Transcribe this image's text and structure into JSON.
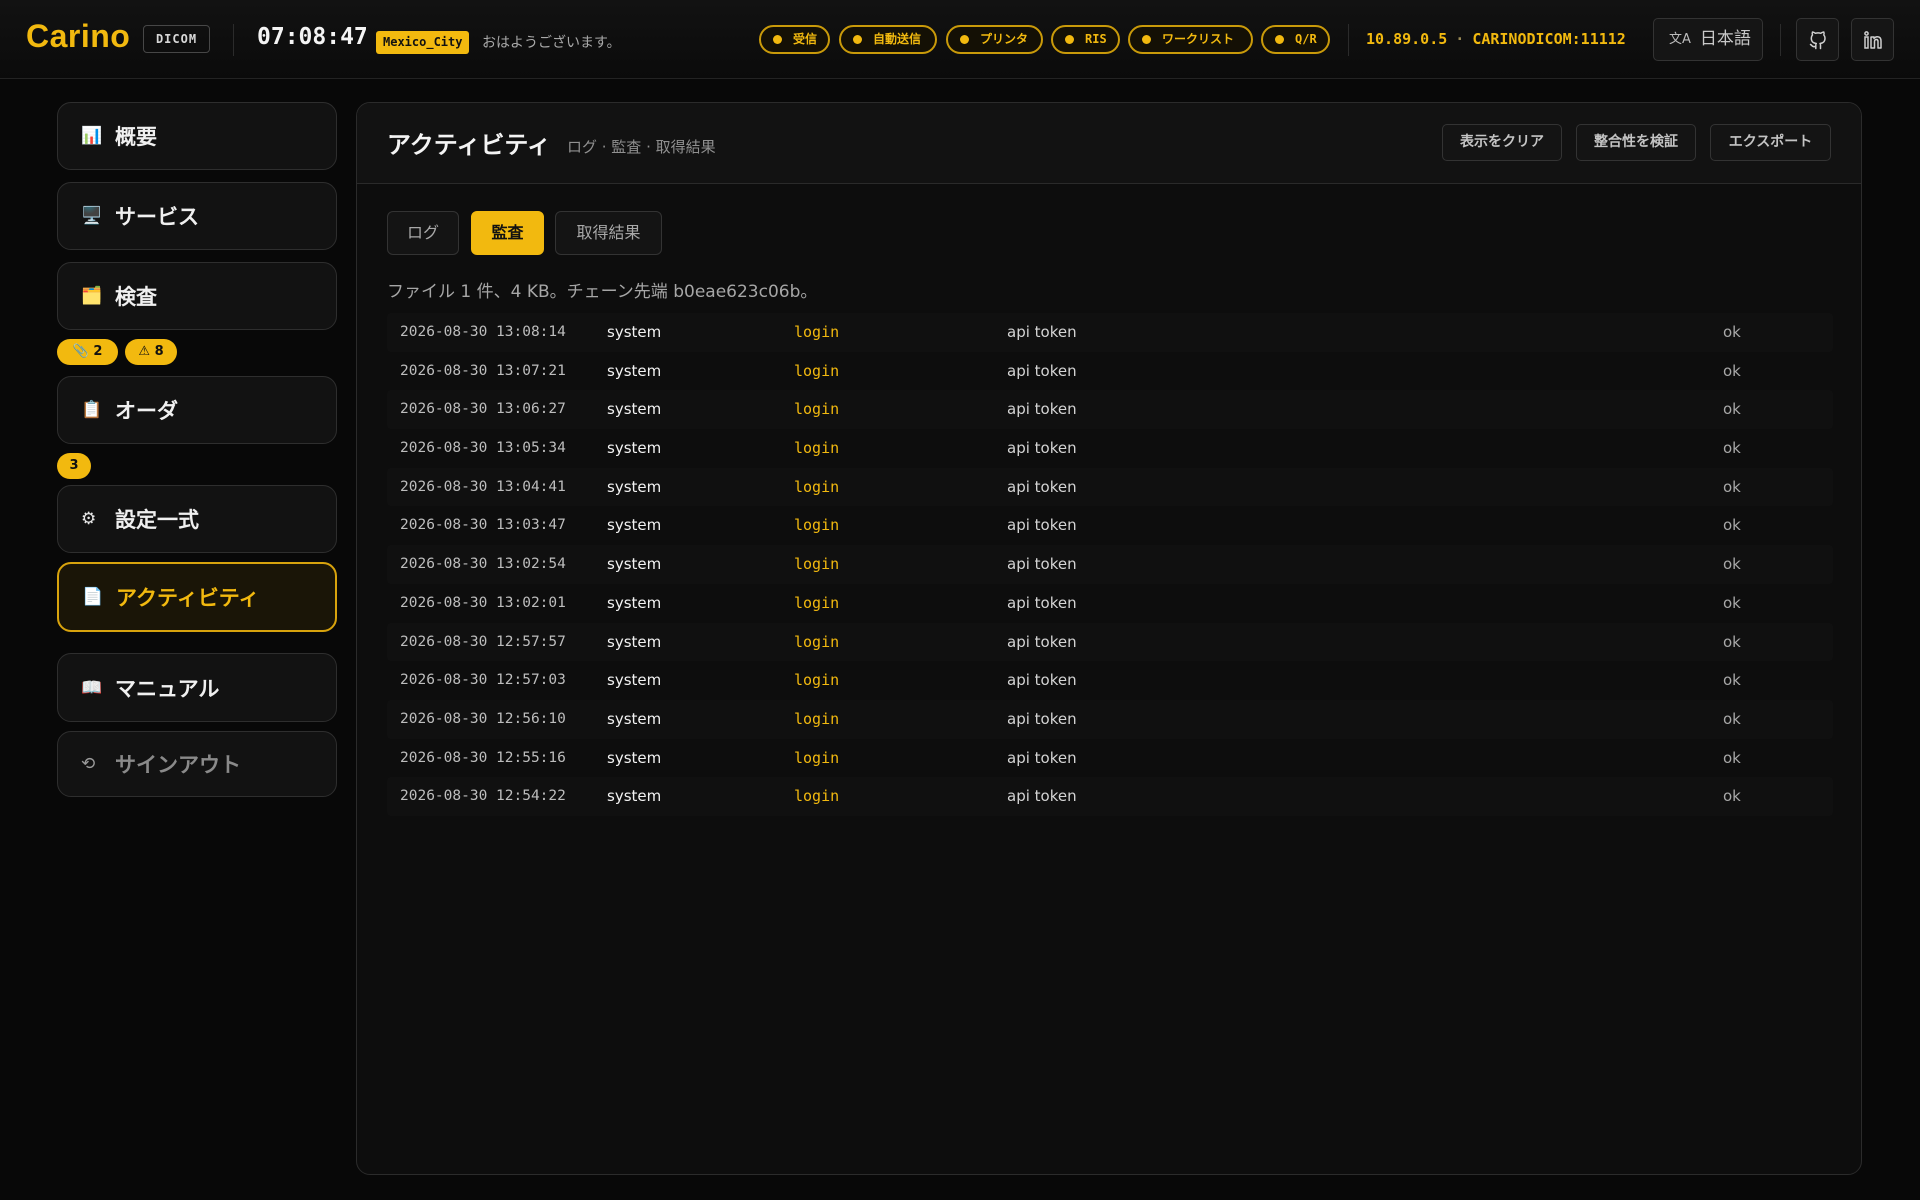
{
  "header": {
    "brand": "Carino",
    "brand_tag": "DICOM",
    "clock": "07:08:47",
    "timezone": "Mexico_City",
    "greeting": "おはようございます。",
    "status_pills": [
      "受信",
      "自動送信",
      "プリンタ",
      "RIS",
      "ワークリスト",
      "Q/R"
    ],
    "host_ip": "10.89.0.5",
    "host_sep": "·",
    "host_ae": "CARINODICOM:11112",
    "language": "日本語",
    "github_icon": "github-icon",
    "linkedin_icon": "linkedin-icon"
  },
  "sidebar": {
    "items": [
      {
        "label": "概要",
        "icon": "📊",
        "icon_name": "chart-icon"
      },
      {
        "label": "サービス",
        "icon": "🖥️",
        "icon_name": "monitor-icon"
      },
      {
        "label": "検査",
        "icon": "🗂️",
        "icon_name": "folder-icon"
      },
      {
        "label": "オーダ",
        "icon": "📋",
        "icon_name": "clipboard-icon"
      },
      {
        "label": "設定一式",
        "icon": "⚙",
        "icon_name": "gear-icon"
      },
      {
        "label": "アクティビティ",
        "icon": "📄",
        "icon_name": "document-icon"
      },
      {
        "label": "マニュアル",
        "icon": "📖",
        "icon_name": "book-icon"
      },
      {
        "label": "サインアウト",
        "icon": "⟲",
        "icon_name": "signout-icon"
      }
    ],
    "exam_badges": [
      {
        "icon": "📎",
        "count": "2"
      },
      {
        "icon": "⚠",
        "count": "8"
      }
    ],
    "order_badge": "3"
  },
  "main": {
    "title": "アクティビティ",
    "subtitle": "ログ · 監査 · 取得結果",
    "buttons": {
      "clear": "表示をクリア",
      "verify": "整合性を検証",
      "export": "エクスポート"
    },
    "tabs": [
      {
        "label": "ログ",
        "active": false
      },
      {
        "label": "監査",
        "active": true
      },
      {
        "label": "取得結果",
        "active": false
      }
    ],
    "summary": "ファイル 1 件、4 KB。チェーン先端 b0eae623c06b。",
    "rows": [
      {
        "time": "2026-08-30 13:08:14",
        "user": "system",
        "action": "login",
        "detail": "api token",
        "result": "ok"
      },
      {
        "time": "2026-08-30 13:07:21",
        "user": "system",
        "action": "login",
        "detail": "api token",
        "result": "ok"
      },
      {
        "time": "2026-08-30 13:06:27",
        "user": "system",
        "action": "login",
        "detail": "api token",
        "result": "ok"
      },
      {
        "time": "2026-08-30 13:05:34",
        "user": "system",
        "action": "login",
        "detail": "api token",
        "result": "ok"
      },
      {
        "time": "2026-08-30 13:04:41",
        "user": "system",
        "action": "login",
        "detail": "api token",
        "result": "ok"
      },
      {
        "time": "2026-08-30 13:03:47",
        "user": "system",
        "action": "login",
        "detail": "api token",
        "result": "ok"
      },
      {
        "time": "2026-08-30 13:02:54",
        "user": "system",
        "action": "login",
        "detail": "api token",
        "result": "ok"
      },
      {
        "time": "2026-08-30 13:02:01",
        "user": "system",
        "action": "login",
        "detail": "api token",
        "result": "ok"
      },
      {
        "time": "2026-08-30 12:57:57",
        "user": "system",
        "action": "login",
        "detail": "api token",
        "result": "ok"
      },
      {
        "time": "2026-08-30 12:57:03",
        "user": "system",
        "action": "login",
        "detail": "api token",
        "result": "ok"
      },
      {
        "time": "2026-08-30 12:56:10",
        "user": "system",
        "action": "login",
        "detail": "api token",
        "result": "ok"
      },
      {
        "time": "2026-08-30 12:55:16",
        "user": "system",
        "action": "login",
        "detail": "api token",
        "result": "ok"
      },
      {
        "time": "2026-08-30 12:54:22",
        "user": "system",
        "action": "login",
        "detail": "api token",
        "result": "ok"
      }
    ]
  },
  "colors": {
    "accent": "#f2b90f",
    "background": "#080808",
    "panel": "#0d0d0d"
  }
}
